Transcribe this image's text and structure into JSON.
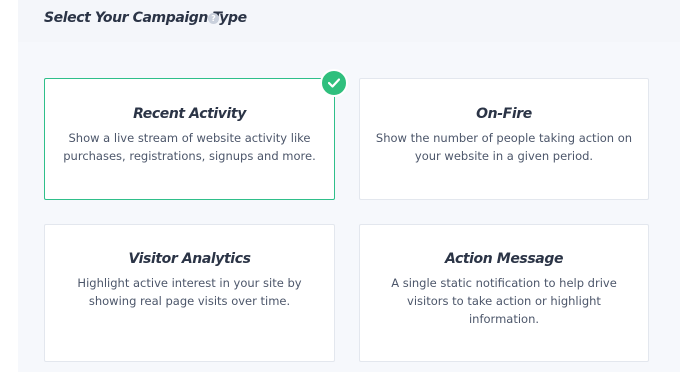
{
  "header": {
    "title": "Select Your Campaign Type",
    "help_icon": "question-circle-icon"
  },
  "cards": [
    {
      "title": "Recent Activity",
      "description": "Show a live stream of website activity like purchases, registrations, signups and more.",
      "selected": true
    },
    {
      "title": "On-Fire",
      "description": "Show the number of people taking action on your website in a given period.",
      "selected": false
    },
    {
      "title": "Visitor Analytics",
      "description": "Highlight active interest in your site by showing real page visits over time.",
      "selected": false
    },
    {
      "title": "Action Message",
      "description": "A single static notification to help drive visitors to take action or highlight information.",
      "selected": false
    }
  ],
  "colors": {
    "accent": "#2fbf7d",
    "selected_border": "#2fbf8a",
    "title_text": "#2b3446",
    "body_text": "#4c566a",
    "panel_background": "#f6f8fc"
  }
}
